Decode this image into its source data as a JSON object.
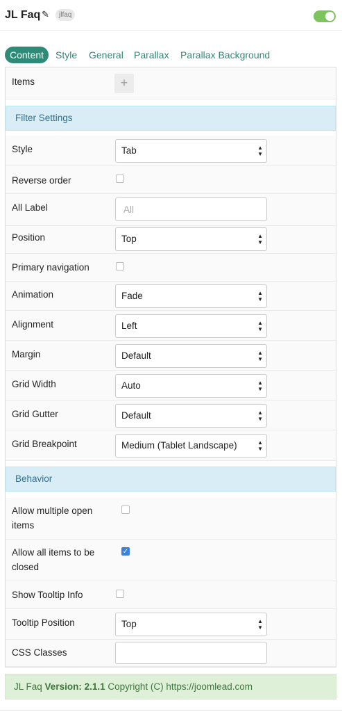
{
  "header": {
    "title": "JL Faq",
    "edit_icon": "pencil-icon",
    "tag": "jlfaq",
    "enabled": true
  },
  "tabs": [
    {
      "label": "Content",
      "active": true
    },
    {
      "label": "Style",
      "active": false
    },
    {
      "label": "General",
      "active": false
    },
    {
      "label": "Parallax",
      "active": false
    },
    {
      "label": "Parallax Background",
      "active": false
    }
  ],
  "items": {
    "label": "Items",
    "add_symbol": "+"
  },
  "filter_section": {
    "title": "Filter Settings"
  },
  "filter": {
    "style": {
      "label": "Style",
      "value": "Tab"
    },
    "reverse_order": {
      "label": "Reverse order",
      "checked": false
    },
    "all_label": {
      "label": "All Label",
      "placeholder": "All"
    },
    "position": {
      "label": "Position",
      "value": "Top"
    },
    "primary_navigation": {
      "label": "Primary navigation",
      "checked": false
    },
    "animation": {
      "label": "Animation",
      "value": "Fade"
    },
    "alignment": {
      "label": "Alignment",
      "value": "Left"
    },
    "margin": {
      "label": "Margin",
      "value": "Default"
    },
    "grid_width": {
      "label": "Grid Width",
      "value": "Auto"
    },
    "grid_gutter": {
      "label": "Grid Gutter",
      "value": "Default"
    },
    "grid_breakpoint": {
      "label": "Grid Breakpoint",
      "value": "Medium (Tablet Landscape)"
    }
  },
  "behavior_section": {
    "title": "Behavior"
  },
  "behavior": {
    "allow_multiple": {
      "label_line1": "Allow multiple open",
      "label_line2": "items",
      "checked": false
    },
    "allow_all_closed": {
      "label_line1": "Allow all items to be",
      "label_line2": "closed",
      "checked": true
    },
    "show_tooltip": {
      "label": "Show Tooltip Info",
      "checked": false
    },
    "tooltip_position": {
      "label": "Tooltip Position",
      "value": "Top"
    },
    "css_classes": {
      "label": "CSS Classes",
      "value": ""
    }
  },
  "footer": {
    "name": "JL Faq",
    "version_label": "Version: 2.1.1",
    "copyright": "Copyright (C)",
    "link": "https://joomlead.com"
  },
  "colors": {
    "accent": "#2e8b77",
    "section_bg": "#d9edf7",
    "section_text": "#31708f",
    "footer_bg": "#dff0d8",
    "toggle_on": "#7dc45e",
    "checkbox_checked": "#3b82e0"
  }
}
